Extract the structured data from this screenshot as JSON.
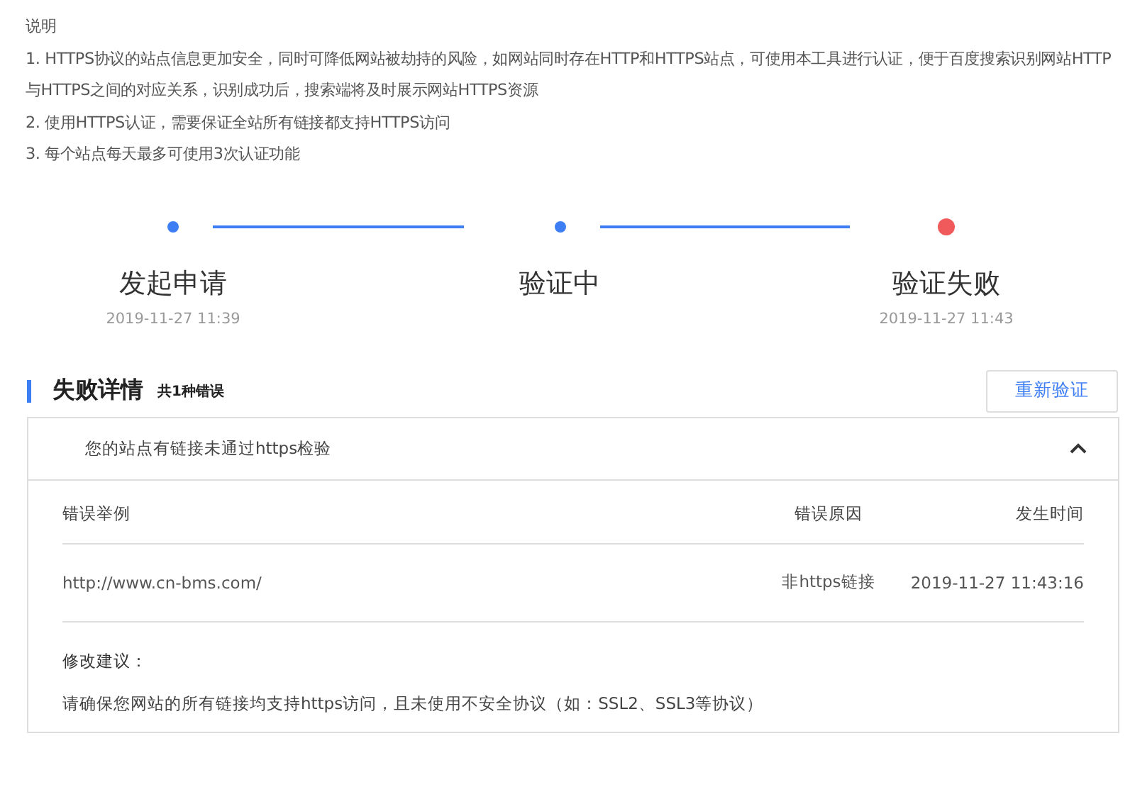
{
  "intro": {
    "heading": "说明",
    "items": [
      "1. HTTPS协议的站点信息更加安全，同时可降低网站被劫持的风险，如网站同时存在HTTP和HTTPS站点，可使用本工具进行认证，便于百度搜索识别网站HTTP与HTTPS之间的对应关系，识别成功后，搜索端将及时展示网站HTTPS资源",
      "2. 使用HTTPS认证，需要保证全站所有链接都支持HTTPS访问",
      "3. 每个站点每天最多可使用3次认证功能"
    ]
  },
  "steps": [
    {
      "title": "发起申请",
      "time": "2019-11-27 11:39",
      "kind": "done"
    },
    {
      "title": "验证中",
      "kind": "done"
    },
    {
      "title": "验证失败",
      "time": "2019-11-27 11:43",
      "kind": "failed"
    }
  ],
  "details": {
    "title": "失败详情",
    "count": "共1种错误",
    "retry_button": "重新验证",
    "panel": {
      "summary": "您的站点有链接未通过https检验",
      "expanded": true,
      "columns": [
        "错误举例",
        "错误原因",
        "发生时间"
      ],
      "rows": [
        [
          "http://www.cn-bms.com/",
          "非https链接",
          "2019-11-27 11:43:16"
        ]
      ],
      "suggestion_label": "修改建议：",
      "suggestion": "请确保您网站的所有链接均支持https访问，且未使用不安全协议（如：SSL2、SSL3等协议）"
    }
  }
}
